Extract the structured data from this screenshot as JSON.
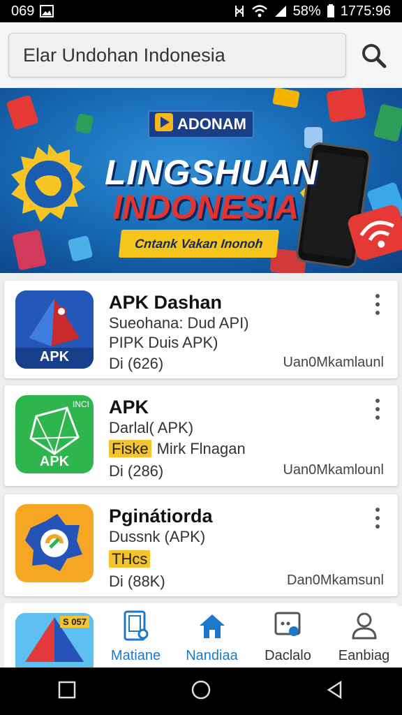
{
  "status_bar": {
    "time": "069",
    "battery": "58%",
    "clock": "1775:96"
  },
  "search": {
    "value": "Elar Undohan Indonesia"
  },
  "banner": {
    "brand": "ADONAM",
    "title_line1": "LINGSHUAN",
    "title_line2": "INDONESIA",
    "ribbon": "Cntank Vakan Inonoh"
  },
  "apps": [
    {
      "name": "APK Dashan",
      "line1": "Sueohana: Dud API)",
      "line2": "PIPK Duis APK)",
      "meta": "Di (626)",
      "developer": "Uan0Mkamlaunl",
      "icon_text": "APK"
    },
    {
      "name": "APK",
      "line1": "Darlal( APK)",
      "tag": "Fiske",
      "line2": "Mirk Flnagan",
      "meta": "Di (286)",
      "developer": "Uan0Mkamlounl",
      "icon_text": "APK",
      "icon_corner": "INCI"
    },
    {
      "name": "Pginátiorda",
      "line1": "Dussnk (APK)",
      "tag": "THcs",
      "meta": "Di (88K)",
      "developer": "Dan0Mkamsunl"
    }
  ],
  "peek_card": {
    "badge": "S 057"
  },
  "bottom_nav": [
    {
      "label": "Matiane",
      "icon": "tablet-icon",
      "active": true
    },
    {
      "label": "Nandiaa",
      "icon": "home-icon",
      "active": true
    },
    {
      "label": "Daclalo",
      "icon": "chat-icon",
      "active": false
    },
    {
      "label": "Eanbiag",
      "icon": "person-icon",
      "active": false
    }
  ],
  "colors": {
    "accent": "#1c78c8",
    "tag": "#f4c430",
    "banner": "#1565b0"
  }
}
